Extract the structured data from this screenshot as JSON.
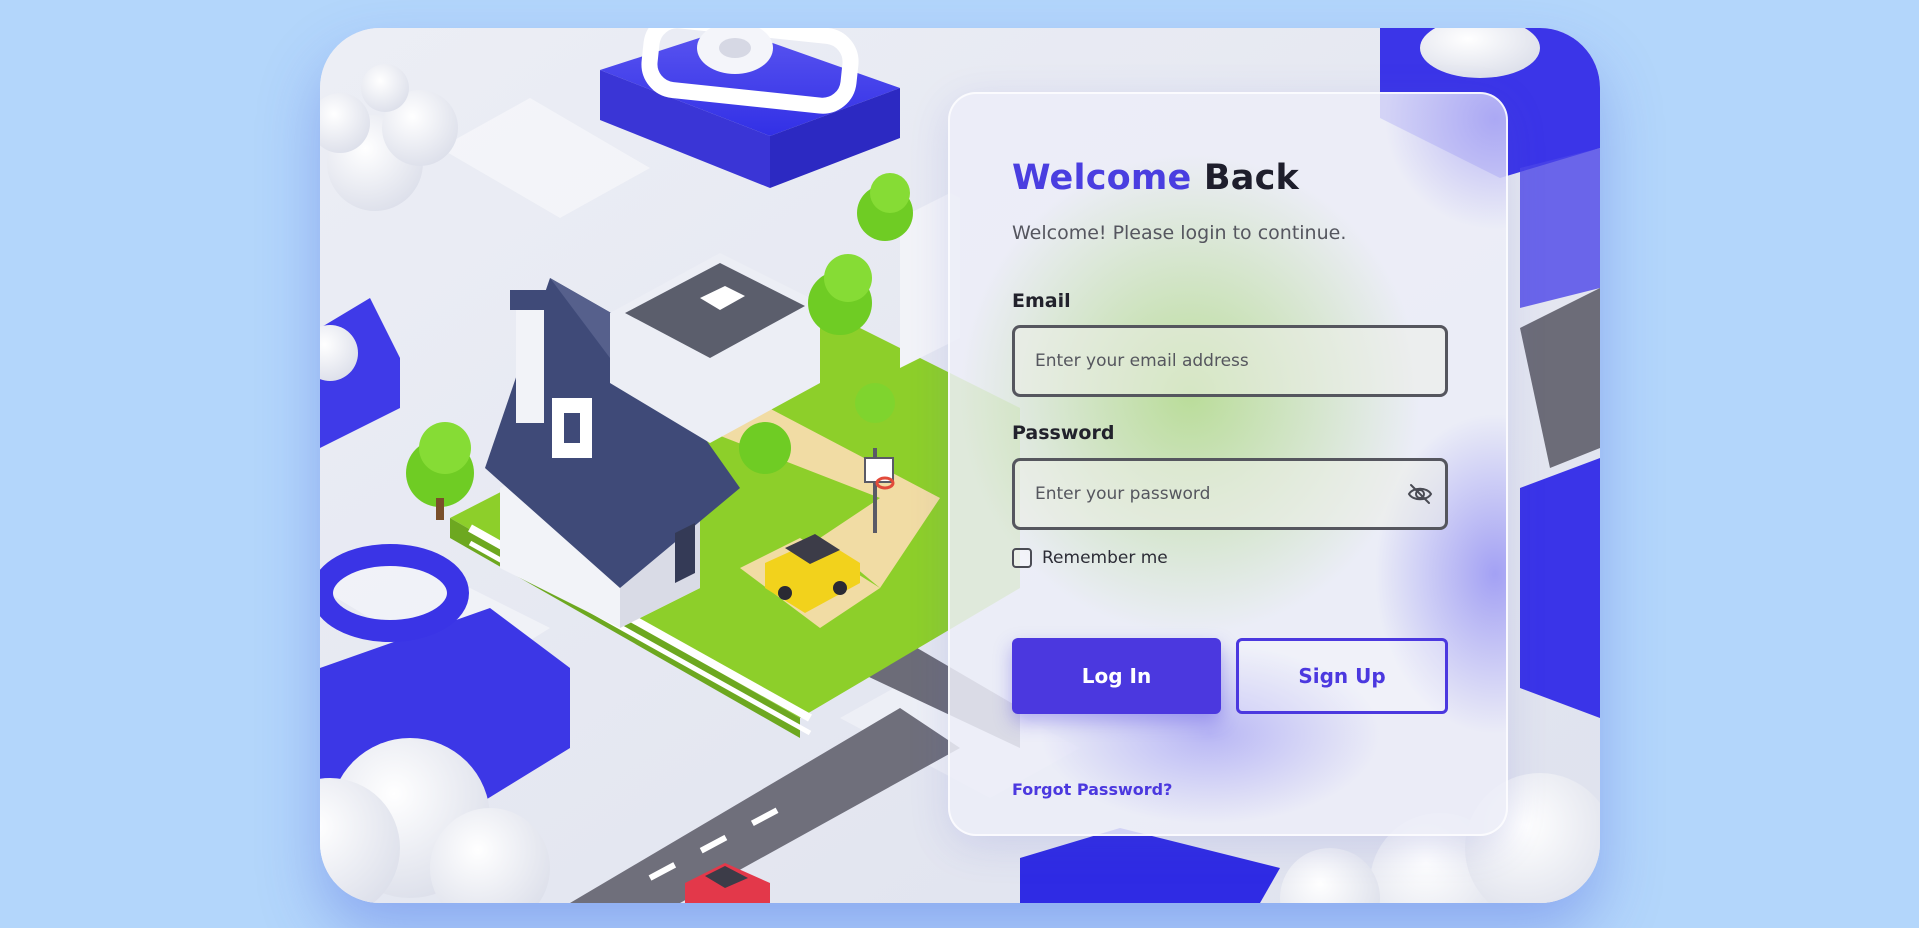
{
  "card": {
    "title_accent": "Welcome",
    "title_rest": "Back",
    "subtitle": "Welcome! Please login to continue."
  },
  "email": {
    "label": "Email",
    "placeholder": "Enter your email address",
    "value": ""
  },
  "password": {
    "label": "Password",
    "placeholder": "Enter your password",
    "value": "",
    "toggle_icon": "eye-off-icon"
  },
  "remember": {
    "label": "Remember me",
    "checked": false
  },
  "buttons": {
    "login": "Log In",
    "signup": "Sign Up"
  },
  "links": {
    "forgot": "Forgot Password?"
  },
  "colors": {
    "accent": "#4b38df",
    "page_background": "#b3d6fb",
    "heading_dark": "#1e1e2c"
  }
}
